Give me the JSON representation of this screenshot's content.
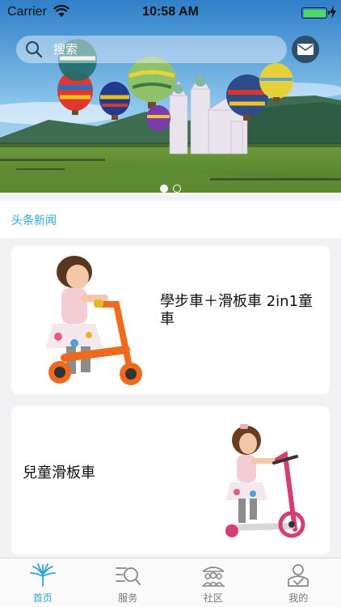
{
  "status_bar": {
    "carrier": "Carrier",
    "time": "10:58 AM"
  },
  "search": {
    "placeholder": "搜索"
  },
  "banner": {
    "page_count": 2,
    "active_page": 1
  },
  "section": {
    "title": "头条新闻"
  },
  "news": [
    {
      "title": "學步車＋滑板車 2in1童車"
    },
    {
      "title": "兒童滑板車"
    }
  ],
  "tabs": [
    {
      "label": "首页",
      "icon": "lotus-icon",
      "active": true
    },
    {
      "label": "服务",
      "icon": "service-search-icon",
      "active": false
    },
    {
      "label": "社区",
      "icon": "community-icon",
      "active": false
    },
    {
      "label": "我的",
      "icon": "profile-icon",
      "active": false
    }
  ],
  "colors": {
    "accent": "#2ea3d8",
    "mail_button": "#2e4f6b",
    "battery": "#4cd964"
  }
}
